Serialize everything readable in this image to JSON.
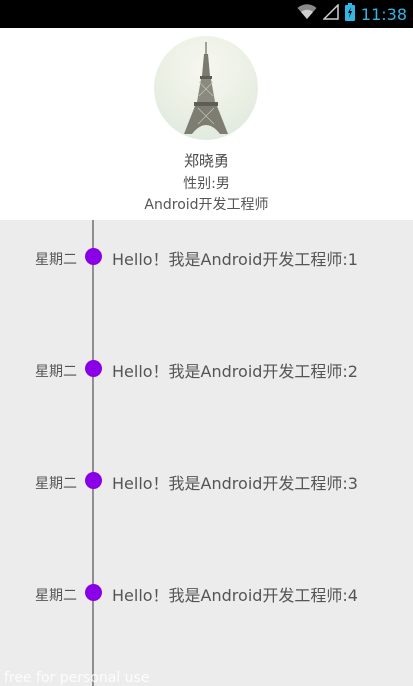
{
  "status_bar": {
    "time": "11:38",
    "icons": [
      "wifi-icon",
      "signal-icon",
      "battery-icon"
    ],
    "accent_color": "#33b5e5"
  },
  "profile": {
    "avatar": "eiffel-tower-avatar",
    "name": "郑晓勇",
    "gender": "性别:男",
    "job": "Android开发工程师"
  },
  "timeline": {
    "dot_color": "#8a00e6",
    "items": [
      {
        "date": "星期二",
        "text": "Hello！我是Android开发工程师:1"
      },
      {
        "date": "星期二",
        "text": "Hello！我是Android开发工程师:2"
      },
      {
        "date": "星期二",
        "text": "Hello！我是Android开发工程师:3"
      },
      {
        "date": "星期二",
        "text": "Hello！我是Android开发工程师:4"
      }
    ]
  },
  "watermark": "free for personal use"
}
